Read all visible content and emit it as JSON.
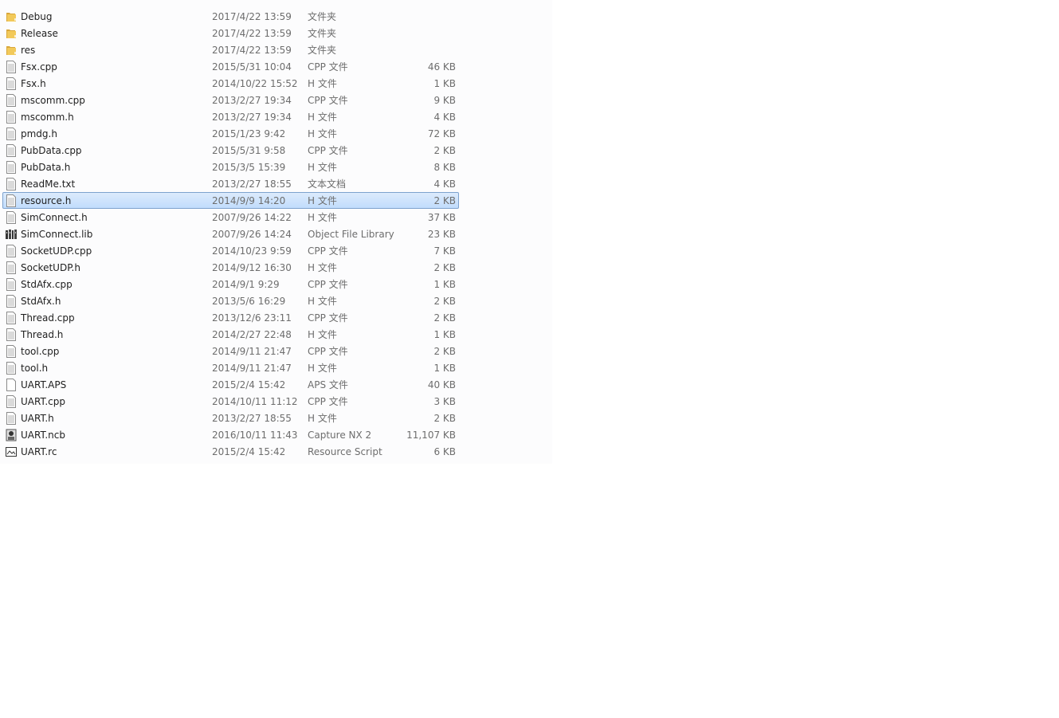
{
  "selected_index": 11,
  "colors": {
    "folder": "#e8b84a",
    "selection_bg": "#cde3fb",
    "selection_border": "#7da2ce"
  },
  "files": [
    {
      "name": "Debug",
      "date": "2017/4/22 13:59",
      "type": "文件夹",
      "size": "",
      "icon": "folder-icon"
    },
    {
      "name": "Release",
      "date": "2017/4/22 13:59",
      "type": "文件夹",
      "size": "",
      "icon": "folder-icon"
    },
    {
      "name": "res",
      "date": "2017/4/22 13:59",
      "type": "文件夹",
      "size": "",
      "icon": "folder-icon"
    },
    {
      "name": "Fsx.cpp",
      "date": "2015/5/31 10:04",
      "type": "CPP 文件",
      "size": "46 KB",
      "icon": "text-file-icon"
    },
    {
      "name": "Fsx.h",
      "date": "2014/10/22 15:52",
      "type": "H 文件",
      "size": "1 KB",
      "icon": "text-file-icon"
    },
    {
      "name": "mscomm.cpp",
      "date": "2013/2/27 19:34",
      "type": "CPP 文件",
      "size": "9 KB",
      "icon": "text-file-icon"
    },
    {
      "name": "mscomm.h",
      "date": "2013/2/27 19:34",
      "type": "H 文件",
      "size": "4 KB",
      "icon": "text-file-icon"
    },
    {
      "name": "pmdg.h",
      "date": "2015/1/23 9:42",
      "type": "H 文件",
      "size": "72 KB",
      "icon": "text-file-icon"
    },
    {
      "name": "PubData.cpp",
      "date": "2015/5/31 9:58",
      "type": "CPP 文件",
      "size": "2 KB",
      "icon": "text-file-icon"
    },
    {
      "name": "PubData.h",
      "date": "2015/3/5 15:39",
      "type": "H 文件",
      "size": "8 KB",
      "icon": "text-file-icon"
    },
    {
      "name": "ReadMe.txt",
      "date": "2013/2/27 18:55",
      "type": "文本文档",
      "size": "4 KB",
      "icon": "text-file-icon"
    },
    {
      "name": "resource.h",
      "date": "2014/9/9 14:20",
      "type": "H 文件",
      "size": "2 KB",
      "icon": "text-file-icon"
    },
    {
      "name": "SimConnect.h",
      "date": "2007/9/26 14:22",
      "type": "H 文件",
      "size": "37 KB",
      "icon": "text-file-icon"
    },
    {
      "name": "SimConnect.lib",
      "date": "2007/9/26 14:24",
      "type": "Object File Library",
      "size": "23 KB",
      "icon": "library-file-icon"
    },
    {
      "name": "SocketUDP.cpp",
      "date": "2014/10/23 9:59",
      "type": "CPP 文件",
      "size": "7 KB",
      "icon": "text-file-icon"
    },
    {
      "name": "SocketUDP.h",
      "date": "2014/9/12 16:30",
      "type": "H 文件",
      "size": "2 KB",
      "icon": "text-file-icon"
    },
    {
      "name": "StdAfx.cpp",
      "date": "2014/9/1 9:29",
      "type": "CPP 文件",
      "size": "1 KB",
      "icon": "text-file-icon"
    },
    {
      "name": "StdAfx.h",
      "date": "2013/5/6 16:29",
      "type": "H 文件",
      "size": "2 KB",
      "icon": "text-file-icon"
    },
    {
      "name": "Thread.cpp",
      "date": "2013/12/6 23:11",
      "type": "CPP 文件",
      "size": "2 KB",
      "icon": "text-file-icon"
    },
    {
      "name": "Thread.h",
      "date": "2014/2/27 22:48",
      "type": "H 文件",
      "size": "1 KB",
      "icon": "text-file-icon"
    },
    {
      "name": "tool.cpp",
      "date": "2014/9/11 21:47",
      "type": "CPP 文件",
      "size": "2 KB",
      "icon": "text-file-icon"
    },
    {
      "name": "tool.h",
      "date": "2014/9/11 21:47",
      "type": "H 文件",
      "size": "1 KB",
      "icon": "text-file-icon"
    },
    {
      "name": "UART.APS",
      "date": "2015/2/4 15:42",
      "type": "APS 文件",
      "size": "40 KB",
      "icon": "blank-file-icon"
    },
    {
      "name": "UART.cpp",
      "date": "2014/10/11 11:12",
      "type": "CPP 文件",
      "size": "3 KB",
      "icon": "text-file-icon"
    },
    {
      "name": "UART.h",
      "date": "2013/2/27 18:55",
      "type": "H 文件",
      "size": "2 KB",
      "icon": "text-file-icon"
    },
    {
      "name": "UART.ncb",
      "date": "2016/10/11 11:43",
      "type": "Capture NX 2",
      "size": "11,107 KB",
      "icon": "capture-nx-icon"
    },
    {
      "name": "UART.rc",
      "date": "2015/2/4 15:42",
      "type": "Resource Script",
      "size": "6 KB",
      "icon": "resource-script-icon"
    }
  ]
}
